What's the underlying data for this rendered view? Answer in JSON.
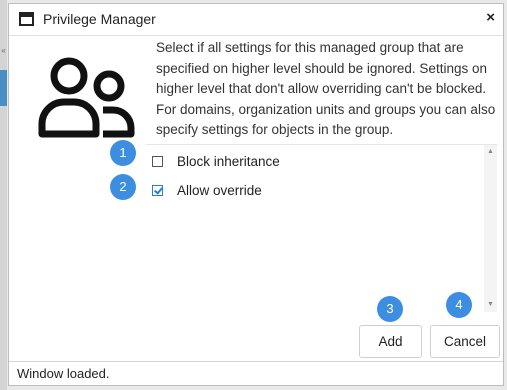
{
  "window": {
    "title": "Privilege Manager",
    "close_glyph": "×"
  },
  "hero_icon": "users-icon",
  "description": {
    "lines": [
      "Select if all settings for this managed group that are specified on higher level should be ignored. Settings on higher level that don't allow overriding can't be blocked.",
      "For domains, organization units and groups you can also specify settings for objects in the group."
    ]
  },
  "options": [
    {
      "label": "Block inheritance",
      "checked": false,
      "badge": "1"
    },
    {
      "label": "Allow override",
      "checked": true,
      "badge": "2"
    }
  ],
  "buttons": {
    "add": {
      "label": "Add",
      "badge": "3"
    },
    "cancel": {
      "label": "Cancel",
      "badge": "4"
    }
  },
  "status": {
    "text": "Window loaded."
  },
  "colors": {
    "badge": "#3d8ee0",
    "checkbox_accent": "#2a7fd4",
    "left_accent": "#4a8fc4"
  }
}
